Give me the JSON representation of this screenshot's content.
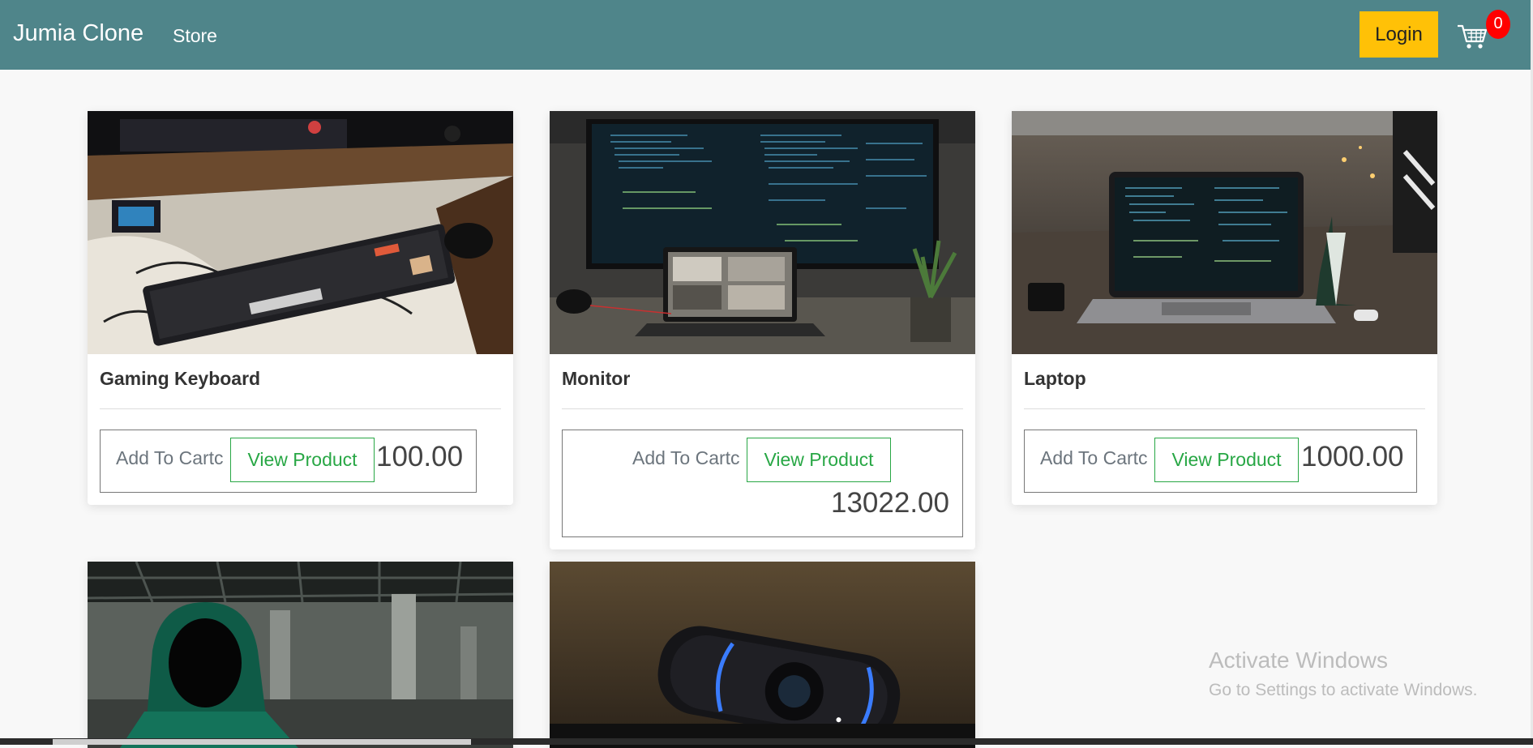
{
  "navbar": {
    "brand": "Jumia Clone",
    "store_link": "Store",
    "login_label": "Login",
    "cart_count": "0",
    "cart_icon": "shopping-cart-icon",
    "bg_color": "#4f858a",
    "login_color": "#ffc107",
    "badge_color": "#ff0000"
  },
  "products": [
    {
      "title": "Gaming Keyboard",
      "add_label": "Add To Cartc",
      "view_label": "View Product",
      "price": "100.00"
    },
    {
      "title": "Monitor",
      "add_label": "Add To Cartc",
      "view_label": "View Product",
      "price": "13022.00"
    },
    {
      "title": "Laptop",
      "add_label": "Add To Cartc",
      "view_label": "View Product",
      "price": "1000.00"
    },
    {
      "image": "hooded-figure-photo"
    },
    {
      "image": "webcam-photo"
    }
  ],
  "watermark": {
    "title": "Activate Windows",
    "subtitle": "Go to Settings to activate Windows."
  }
}
